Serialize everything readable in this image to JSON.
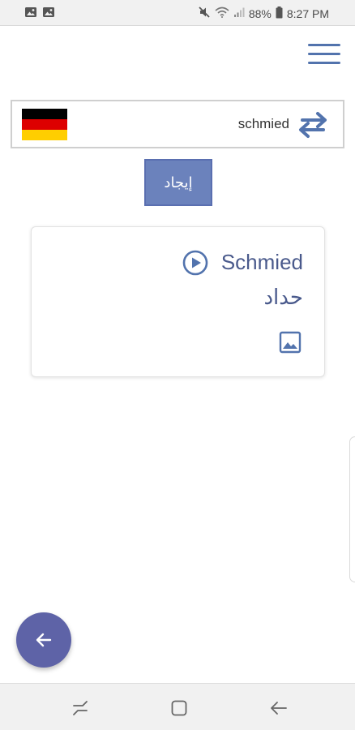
{
  "status_bar": {
    "battery": "88%",
    "time": "8:27 PM",
    "icons": [
      "image-icon",
      "image-icon",
      "mute-icon",
      "wifi-icon",
      "signal-icon",
      "battery-icon"
    ]
  },
  "header": {
    "menu_icon": "hamburger-menu-icon"
  },
  "search": {
    "flag": "germany-flag",
    "value": "schmied",
    "swap_icon": "swap-arrows-icon"
  },
  "find_button": {
    "label": "إيجاد"
  },
  "result": {
    "word": "Schmied",
    "translation": "حداد",
    "play_icon": "play-circle-icon",
    "image_icon": "image-icon"
  },
  "fab": {
    "icon": "arrow-left-icon"
  },
  "navbar": {
    "buttons": [
      "recents-icon",
      "home-icon",
      "back-icon"
    ]
  },
  "colors": {
    "accent": "#5273ad",
    "button": "#6b82bc",
    "fab": "#5e63a7",
    "text": "#4a5a8c"
  }
}
